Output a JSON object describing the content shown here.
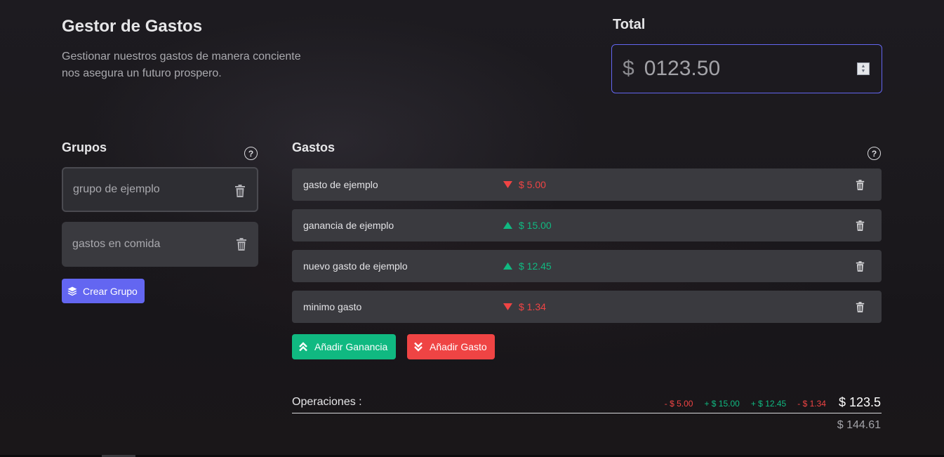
{
  "header": {
    "title": "Gestor de Gastos",
    "subtitle": "Gestionar nuestros gastos de manera conciente nos asegura un futuro prospero."
  },
  "total": {
    "label": "Total",
    "currency": "$",
    "value": "0123.50"
  },
  "groups": {
    "title": "Grupos",
    "help_icon": "question-circle-icon",
    "items": [
      {
        "name": "grupo de ejemplo",
        "selected": true
      },
      {
        "name": "gastos en comida",
        "selected": false
      }
    ],
    "create_label": "Crear Grupo",
    "create_icon": "layers-icon"
  },
  "expenses": {
    "title": "Gastos",
    "help_icon": "question-circle-icon",
    "items": [
      {
        "name": "gasto de ejemplo",
        "amount": "$ 5.00",
        "type": "expense"
      },
      {
        "name": "ganancia de ejemplo",
        "amount": "$ 15.00",
        "type": "income"
      },
      {
        "name": "nuevo gasto de ejemplo",
        "amount": "$ 12.45",
        "type": "income"
      },
      {
        "name": "minimo gasto",
        "amount": "$ 1.34",
        "type": "expense"
      }
    ],
    "add_income_label": "Añadir Ganancia",
    "add_expense_label": "Añadir Gasto"
  },
  "operations": {
    "label": "Operaciones :",
    "items": [
      {
        "text": "- $ 5.00",
        "type": "expense"
      },
      {
        "text": "+ $ 15.00",
        "type": "income"
      },
      {
        "text": "+ $ 12.45",
        "type": "income"
      },
      {
        "text": "- $ 1.34",
        "type": "expense"
      }
    ],
    "result": "$ 123.5",
    "sum": "$ 144.61"
  },
  "colors": {
    "accent": "#6366f1",
    "income": "#10b981",
    "expense": "#ef4444"
  }
}
